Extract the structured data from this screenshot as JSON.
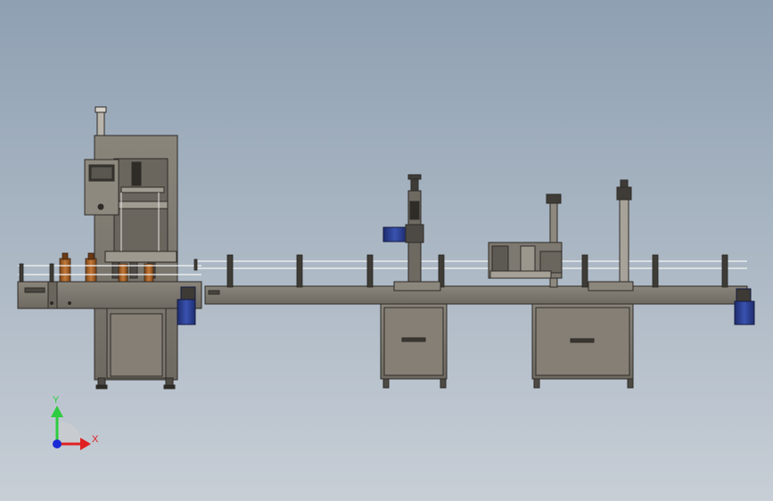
{
  "triad": {
    "x_label": "X",
    "y_label": "Y",
    "x_color": "#e02020",
    "y_color": "#2ecc40",
    "z_color": "#1a2bd6"
  },
  "colors": {
    "frame": "#7a756c",
    "frame_dark": "#3f3c37",
    "panel": "#8c877d",
    "motor": "#2a3d8f",
    "bottle": "#a8642a",
    "rail": "#f2f2f2"
  }
}
